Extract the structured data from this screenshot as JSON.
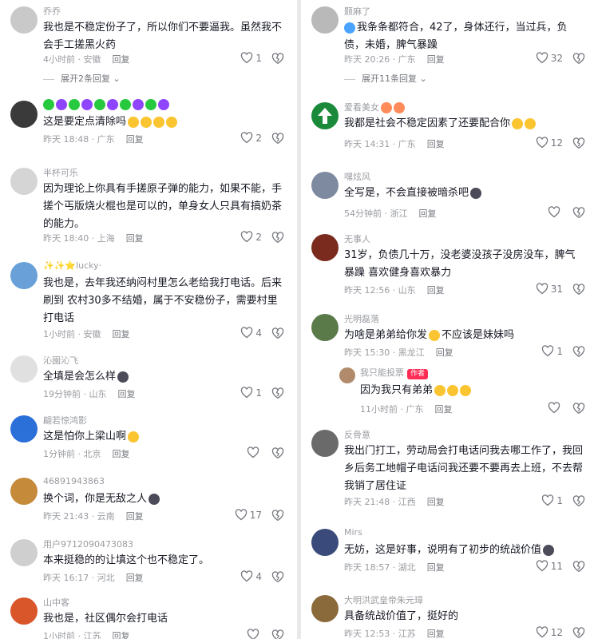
{
  "left": [
    {
      "name": "乔乔",
      "text": "我也是不稳定份子了，所以你们不要逼我。虽然我不会手工搓黑火药",
      "time": "4小时前 · 安徽",
      "reply": "回复",
      "likes": "1",
      "expand": "展开2条回复",
      "avatar_color": "#c9c9c9"
    },
    {
      "name": "",
      "text": "这是要定点清除吗",
      "time": "昨天 18:48 · 广东",
      "reply": "回复",
      "likes": "2",
      "avatar_color": "#3a3a3a"
    },
    {
      "name": "半杯可乐",
      "text": "因为理论上你具有手搓原子弹的能力，如果不能，手搓个丐版烧火棍也是可以的，单身女人只具有搞奶茶的能力。",
      "time": "昨天 18:40 · 上海",
      "reply": "回复",
      "likes": "2",
      "avatar_color": "#d5d5d5"
    },
    {
      "name": "✨✨⭐lucky·",
      "text": "我也是，去年我还纳闷村里怎么老给我打电话。后来刷到 农村30多不结婚，属于不安稳份子，需要村里打电话",
      "time": "1小时前 · 安徽",
      "reply": "回复",
      "likes": "4",
      "avatar_color": "#6aa0d8"
    },
    {
      "name": "沁園沁飞",
      "text": "全填是会怎么样",
      "time": "19分钟前 · 山东",
      "reply": "回复",
      "likes": "1",
      "avatar_color": "#e0e0e0"
    },
    {
      "name": "翩若惊鸿影",
      "text": "这是怕你上梁山啊",
      "time": "1分钟前 · 北京",
      "reply": "回复",
      "likes": "",
      "avatar_color": "#2b6fd8"
    },
    {
      "name": "46891943863",
      "text": "换个词，你是无敌之人",
      "time": "昨天 21:43 · 云南",
      "reply": "回复",
      "likes": "17",
      "avatar_color": "#c58a3a"
    },
    {
      "name": "用户9712090473083",
      "text": "本来挺稳的的让填这个也不稳定了。",
      "time": "昨天 16:17 · 河北",
      "reply": "回复",
      "likes": "4",
      "avatar_color": "#cfcfcf"
    },
    {
      "name": "山中客",
      "text": "我也是，社区偶尔会打电话",
      "time": "1小时前 · 江苏",
      "reply": "回复",
      "likes": "",
      "avatar_color": "#d9562b"
    }
  ],
  "right": [
    {
      "name": "颢麻了",
      "text": "我条条都符合，42了，身体还行，当过兵，负债，未婚，脾气暴躁",
      "time": "昨天 20:26 · 广东",
      "reply": "回复",
      "likes": "32",
      "expand": "展开11条回复",
      "avatar_color": "#b9b9b9"
    },
    {
      "name": "爱看美女",
      "text": "我都是社会不稳定因素了还要配合你",
      "time": "昨天 14:31 · 广东",
      "reply": "回复",
      "likes": "12",
      "avatar_color": "#1a8a3a"
    },
    {
      "name": "嘿炫风",
      "text": "全写是，不会直接被暗杀吧",
      "time": "54分钟前 · 浙江",
      "reply": "回复",
      "likes": "",
      "avatar_color": "#7d8aa0"
    },
    {
      "name": "无事人",
      "text": "31岁，负债几十万，没老婆没孩子没房没车，脾气暴躁 喜欢健身喜欢暴力",
      "time": "昨天 12:56 · 山东",
      "reply": "回复",
      "likes": "31",
      "avatar_color": "#7a2b1e"
    },
    {
      "name": "光明磊落",
      "text": "为啥是弟弟给你发",
      "text2": "不应该是妹妹吗",
      "time": "昨天 15:30 · 黑龙江",
      "reply": "回复",
      "likes": "1",
      "avatar_color": "#5a7a4a"
    },
    {
      "name": "我只能投票",
      "badge": "作者",
      "text": "因为我只有弟弟",
      "time": "11小时前 · 广东",
      "reply": "回复",
      "likes": "",
      "avatar_color": "#b08a6a"
    },
    {
      "name": "反骨意",
      "text": "我出门打工，劳动局会打电话问我去哪工作了，我回乡后务工地帽子电话问我还要不要再去上班，不去帮我销了居住证",
      "time": "昨天 21:48 · 江西",
      "reply": "回复",
      "likes": "1",
      "avatar_color": "#6a6a6a"
    },
    {
      "name": "Mirs",
      "text": "无妨，这是好事，说明有了初步的统战价值",
      "time": "昨天 18:57 · 湖北",
      "reply": "回复",
      "likes": "11",
      "avatar_color": "#3a4a7a"
    },
    {
      "name": "大明洪武皇帝朱元璋",
      "text": "具备统战价值了，挺好的",
      "time": "昨天 12:53 · 江苏",
      "reply": "回复",
      "likes": "12",
      "avatar_color": "#8a6a3a"
    }
  ]
}
